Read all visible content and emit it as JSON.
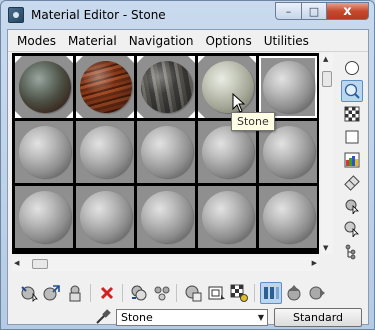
{
  "window": {
    "title": "Material Editor - Stone"
  },
  "caption_buttons": {
    "minimize": "–",
    "maximize": "□",
    "close": "x"
  },
  "menu": [
    "Modes",
    "Material",
    "Navigation",
    "Options",
    "Utilities"
  ],
  "sample_slots": {
    "rows": 3,
    "columns": 5,
    "active_slot": 4,
    "materials": [
      "rock",
      "wood",
      "tile",
      "stone",
      "default",
      "default",
      "default",
      "default",
      "default",
      "default",
      "default",
      "default",
      "default",
      "default",
      "default"
    ]
  },
  "tooltip": {
    "text": "Stone"
  },
  "right_toolbar": [
    "sample-type-sphere-icon",
    "backlight-icon",
    "background-checker-icon",
    "sample-uv-tiling-icon",
    "video-color-check-icon",
    "make-preview-icon",
    "options-icon",
    "select-by-material-icon",
    "material-map-navigator-icon"
  ],
  "bottom_toolbar": [
    "get-material-icon",
    "put-to-scene-icon",
    "assign-to-selection-icon",
    "reset-map-icon",
    "copy-material-icon",
    "make-unique-icon",
    "put-to-library-icon",
    "material-id-channel-icon",
    "show-map-in-viewport-icon",
    "show-end-result-icon",
    "go-to-parent-icon",
    "go-forward-to-sibling-icon"
  ],
  "material_name": "Stone",
  "material_type_button": "Standard",
  "colors": {
    "active_highlight": "#bcd6ef",
    "close_button": "#c74a2f",
    "reset_red": "#d42020"
  }
}
